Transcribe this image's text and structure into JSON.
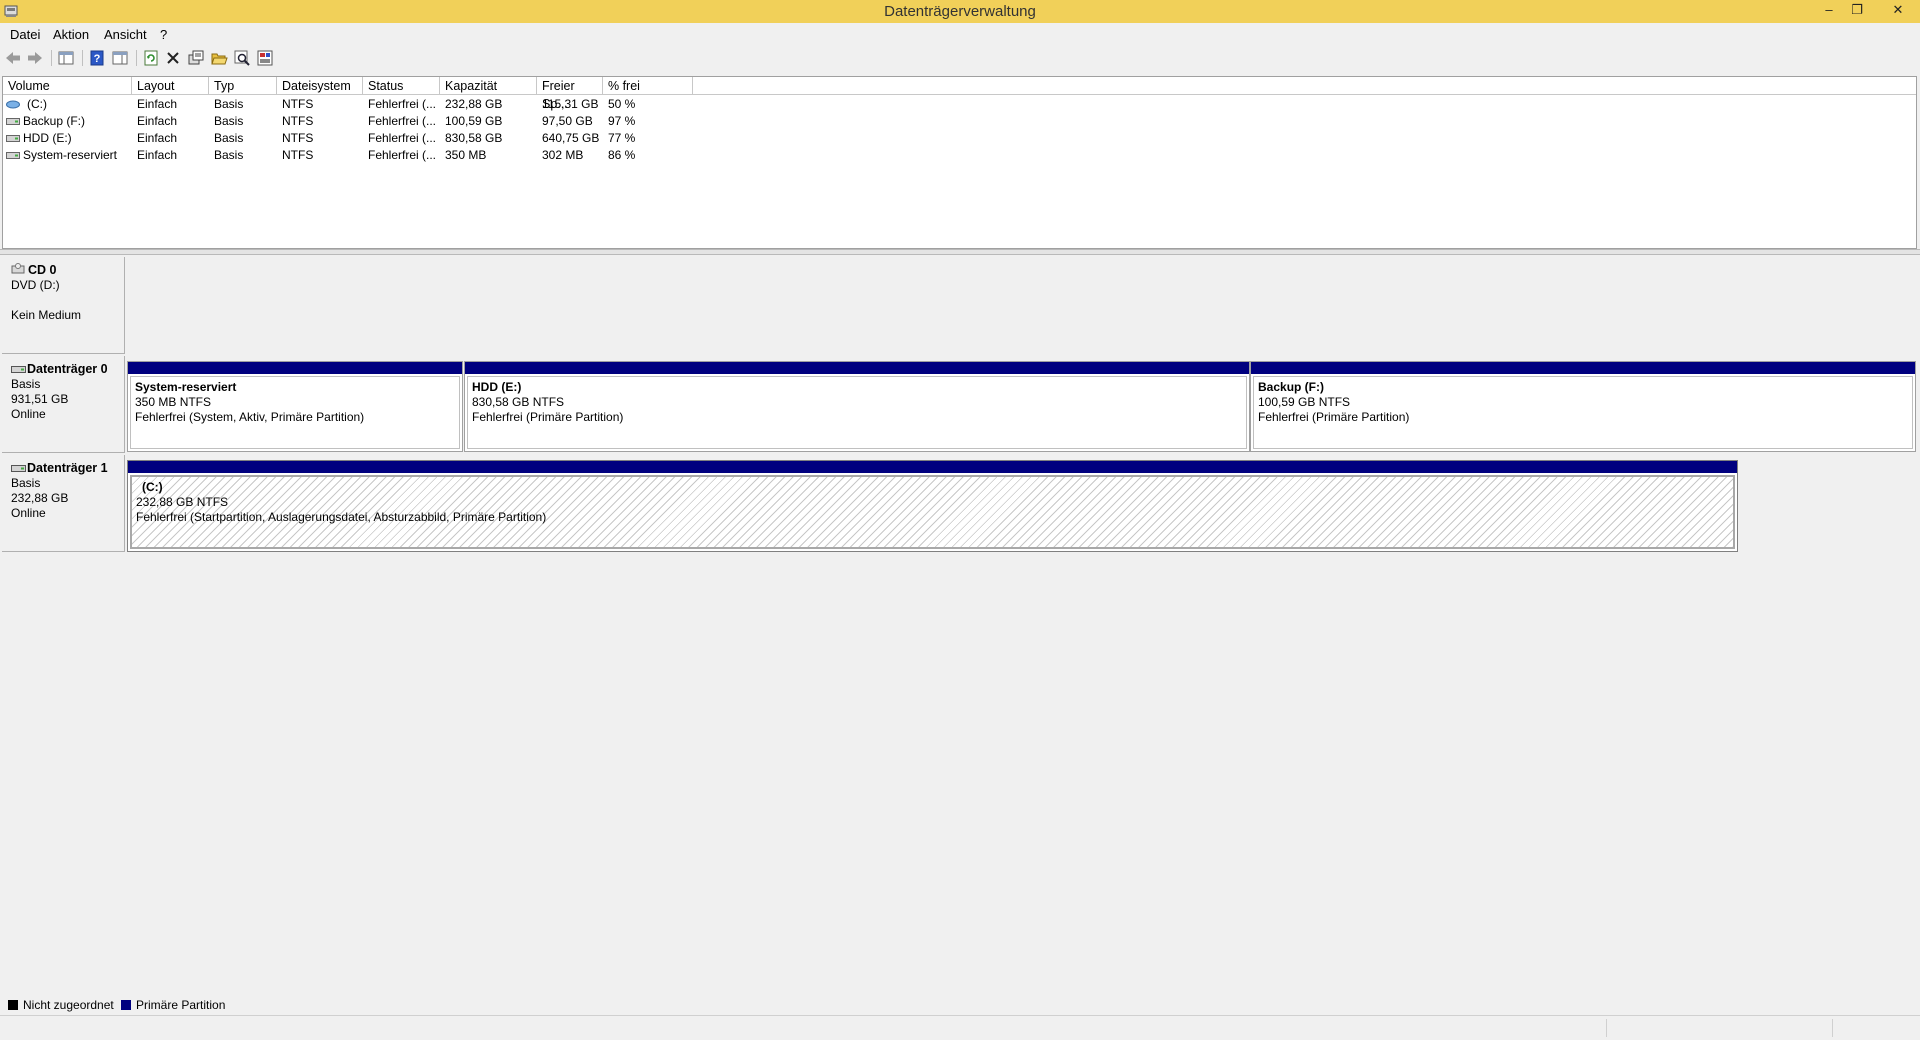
{
  "window": {
    "title": "Datenträgerverwaltung",
    "minimize": "–",
    "restore": "❐",
    "close": "✕"
  },
  "menu": [
    "Datei",
    "Aktion",
    "Ansicht",
    "?"
  ],
  "toolbar": {
    "icons": [
      "back-icon",
      "forward-icon",
      "console-tree-icon",
      "help-icon",
      "properties-panel-icon",
      "refresh-icon",
      "delete-icon",
      "properties-icon",
      "open-icon",
      "search-icon",
      "rescan-disks-icon"
    ]
  },
  "volumes": {
    "columns": [
      "Volume",
      "Layout",
      "Typ",
      "Dateisystem",
      "Status",
      "Kapazität",
      "Freier Sp...",
      "% frei"
    ],
    "rows": [
      {
        "volume": "(C:)",
        "layout": "Einfach",
        "typ": "Basis",
        "fs": "NTFS",
        "status": "Fehlerfrei (...",
        "kap": "232,88 GB",
        "frei": "115,31 GB",
        "pct": "50 %"
      },
      {
        "volume": "Backup (F:)",
        "layout": "Einfach",
        "typ": "Basis",
        "fs": "NTFS",
        "status": "Fehlerfrei (...",
        "kap": "100,59 GB",
        "frei": "97,50 GB",
        "pct": "97 %"
      },
      {
        "volume": "HDD (E:)",
        "layout": "Einfach",
        "typ": "Basis",
        "fs": "NTFS",
        "status": "Fehlerfrei (...",
        "kap": "830,58 GB",
        "frei": "640,75 GB",
        "pct": "77 %"
      },
      {
        "volume": "System-reserviert",
        "layout": "Einfach",
        "typ": "Basis",
        "fs": "NTFS",
        "status": "Fehlerfrei (...",
        "kap": "350 MB",
        "frei": "302 MB",
        "pct": "86 %"
      }
    ]
  },
  "disks": {
    "cd0": {
      "name": "CD 0",
      "line1": "DVD (D:)",
      "line2": "Kein Medium"
    },
    "disk0": {
      "name": "Datenträger 0",
      "type": "Basis",
      "size": "931,51 GB",
      "state": "Online",
      "partitions": [
        {
          "name": "System-reserviert",
          "size": "350 MB NTFS",
          "status": "Fehlerfrei (System, Aktiv, Primäre Partition)"
        },
        {
          "name": "HDD  (E:)",
          "size": "830,58 GB NTFS",
          "status": "Fehlerfrei (Primäre Partition)"
        },
        {
          "name": "Backup  (F:)",
          "size": "100,59 GB NTFS",
          "status": "Fehlerfrei (Primäre Partition)"
        }
      ]
    },
    "disk1": {
      "name": "Datenträger 1",
      "type": "Basis",
      "size": "232,88 GB",
      "state": "Online",
      "partitions": [
        {
          "name": "(C:)",
          "size": "232,88 GB NTFS",
          "status": "Fehlerfrei (Startpartition, Auslagerungsdatei, Absturzabbild, Primäre Partition)"
        }
      ]
    }
  },
  "legend": [
    {
      "label": "Nicht zugeordnet",
      "color": "#000000"
    },
    {
      "label": "Primäre Partition",
      "color": "#00007f"
    }
  ]
}
